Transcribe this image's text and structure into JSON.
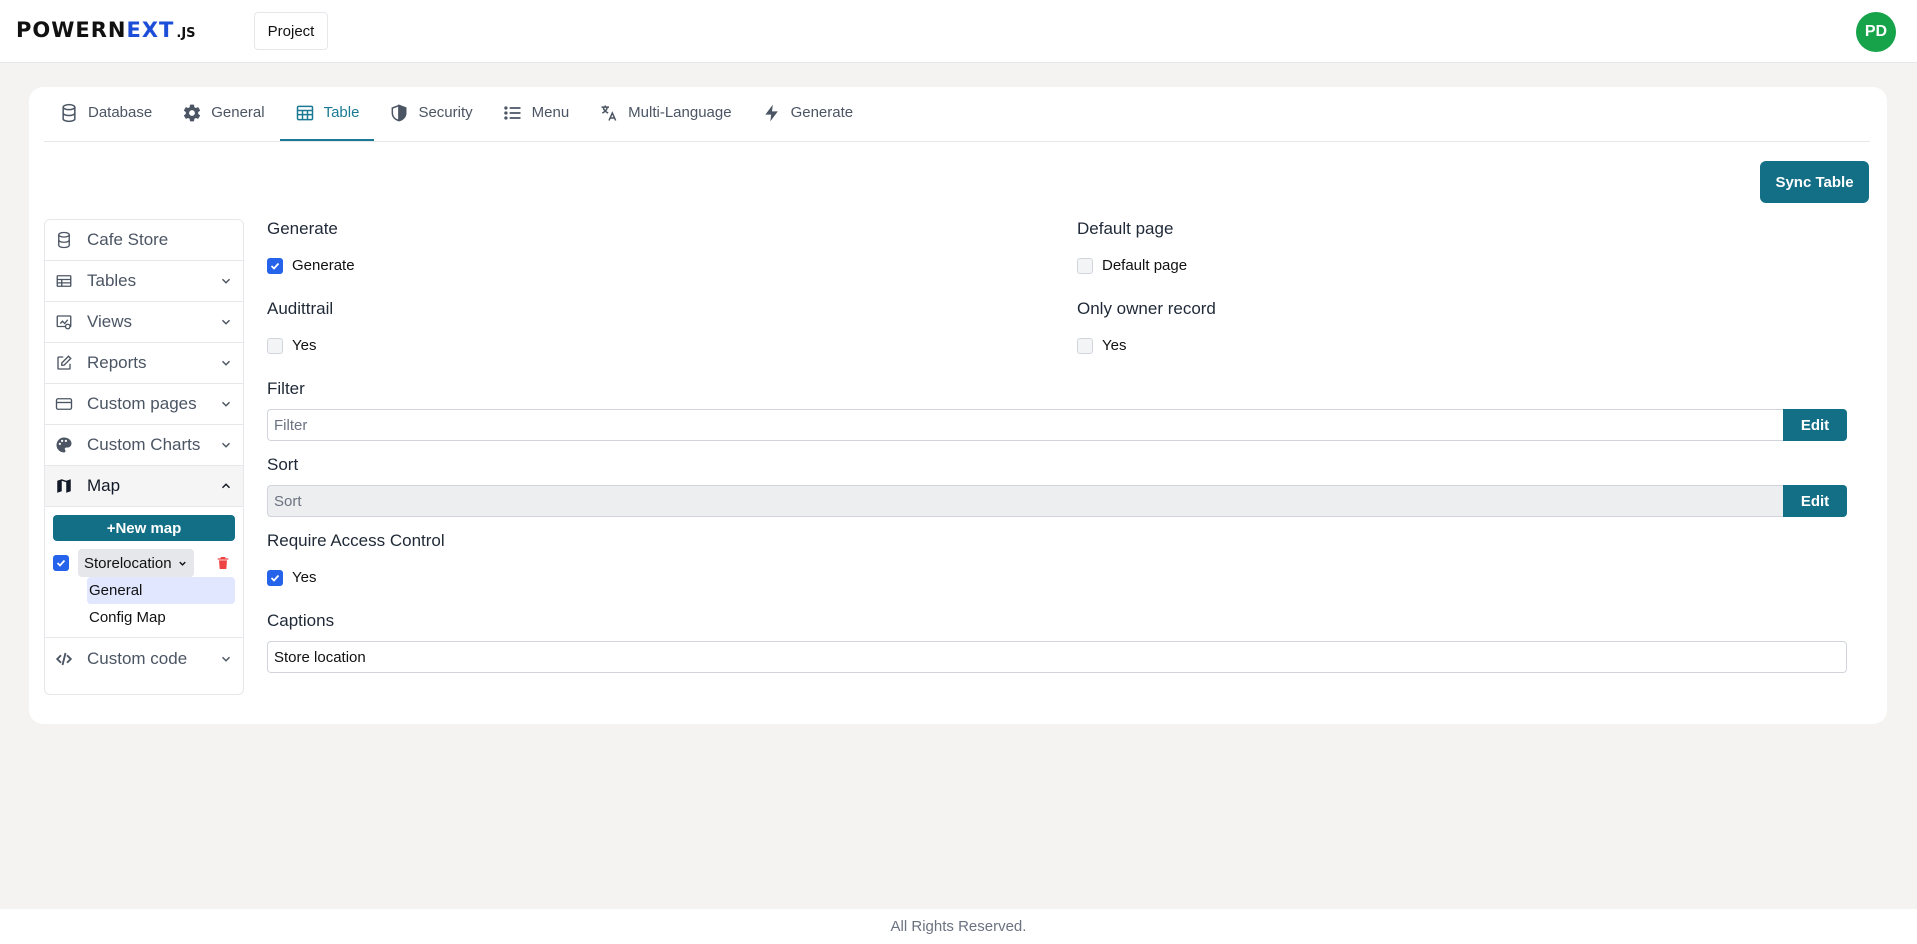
{
  "header": {
    "logo": {
      "part1": "POWERN",
      "part2": "EXT",
      "suffix": ".JS"
    },
    "project_label": "Project",
    "avatar_initials": "PD"
  },
  "tabs": [
    {
      "label": "Database",
      "icon": "database-icon"
    },
    {
      "label": "General",
      "icon": "gear-icon"
    },
    {
      "label": "Table",
      "icon": "table-icon",
      "active": true
    },
    {
      "label": "Security",
      "icon": "shield-icon"
    },
    {
      "label": "Menu",
      "icon": "list-icon"
    },
    {
      "label": "Multi-Language",
      "icon": "translate-icon"
    },
    {
      "label": "Generate",
      "icon": "bolt-icon"
    }
  ],
  "sync_label": "Sync Table",
  "sidebar": {
    "items": [
      {
        "label": "Cafe Store",
        "icon": "database-icon"
      },
      {
        "label": "Tables",
        "icon": "table-icon"
      },
      {
        "label": "Views",
        "icon": "view-icon"
      },
      {
        "label": "Reports",
        "icon": "edit-icon"
      },
      {
        "label": "Custom pages",
        "icon": "card-icon"
      },
      {
        "label": "Custom Charts",
        "icon": "palette-icon"
      },
      {
        "label": "Map",
        "icon": "map-icon"
      },
      {
        "label": "Custom code",
        "icon": "code-icon"
      }
    ],
    "map": {
      "new_label": "+New map",
      "selected": "Storelocation",
      "subitems": [
        "General",
        "Config Map"
      ]
    }
  },
  "form": {
    "generate": {
      "title": "Generate",
      "option": "Generate",
      "checked": true
    },
    "default_page": {
      "title": "Default page",
      "option": "Default page",
      "checked": false
    },
    "audittrail": {
      "title": "Audittrail",
      "option": "Yes",
      "checked": false
    },
    "only_owner": {
      "title": "Only owner record",
      "option": "Yes",
      "checked": false
    },
    "filter": {
      "title": "Filter",
      "placeholder": "Filter",
      "button": "Edit"
    },
    "sort": {
      "title": "Sort",
      "placeholder": "Sort",
      "button": "Edit"
    },
    "require_access": {
      "title": "Require Access Control",
      "option": "Yes",
      "checked": true
    },
    "captions": {
      "title": "Captions",
      "value": "Store location"
    }
  },
  "footer": "All Rights Reserved.",
  "colors": {
    "accent": "#136f86",
    "active_tab": "#1a7a94",
    "checkbox": "#2563eb",
    "avatar": "#16a34a"
  }
}
